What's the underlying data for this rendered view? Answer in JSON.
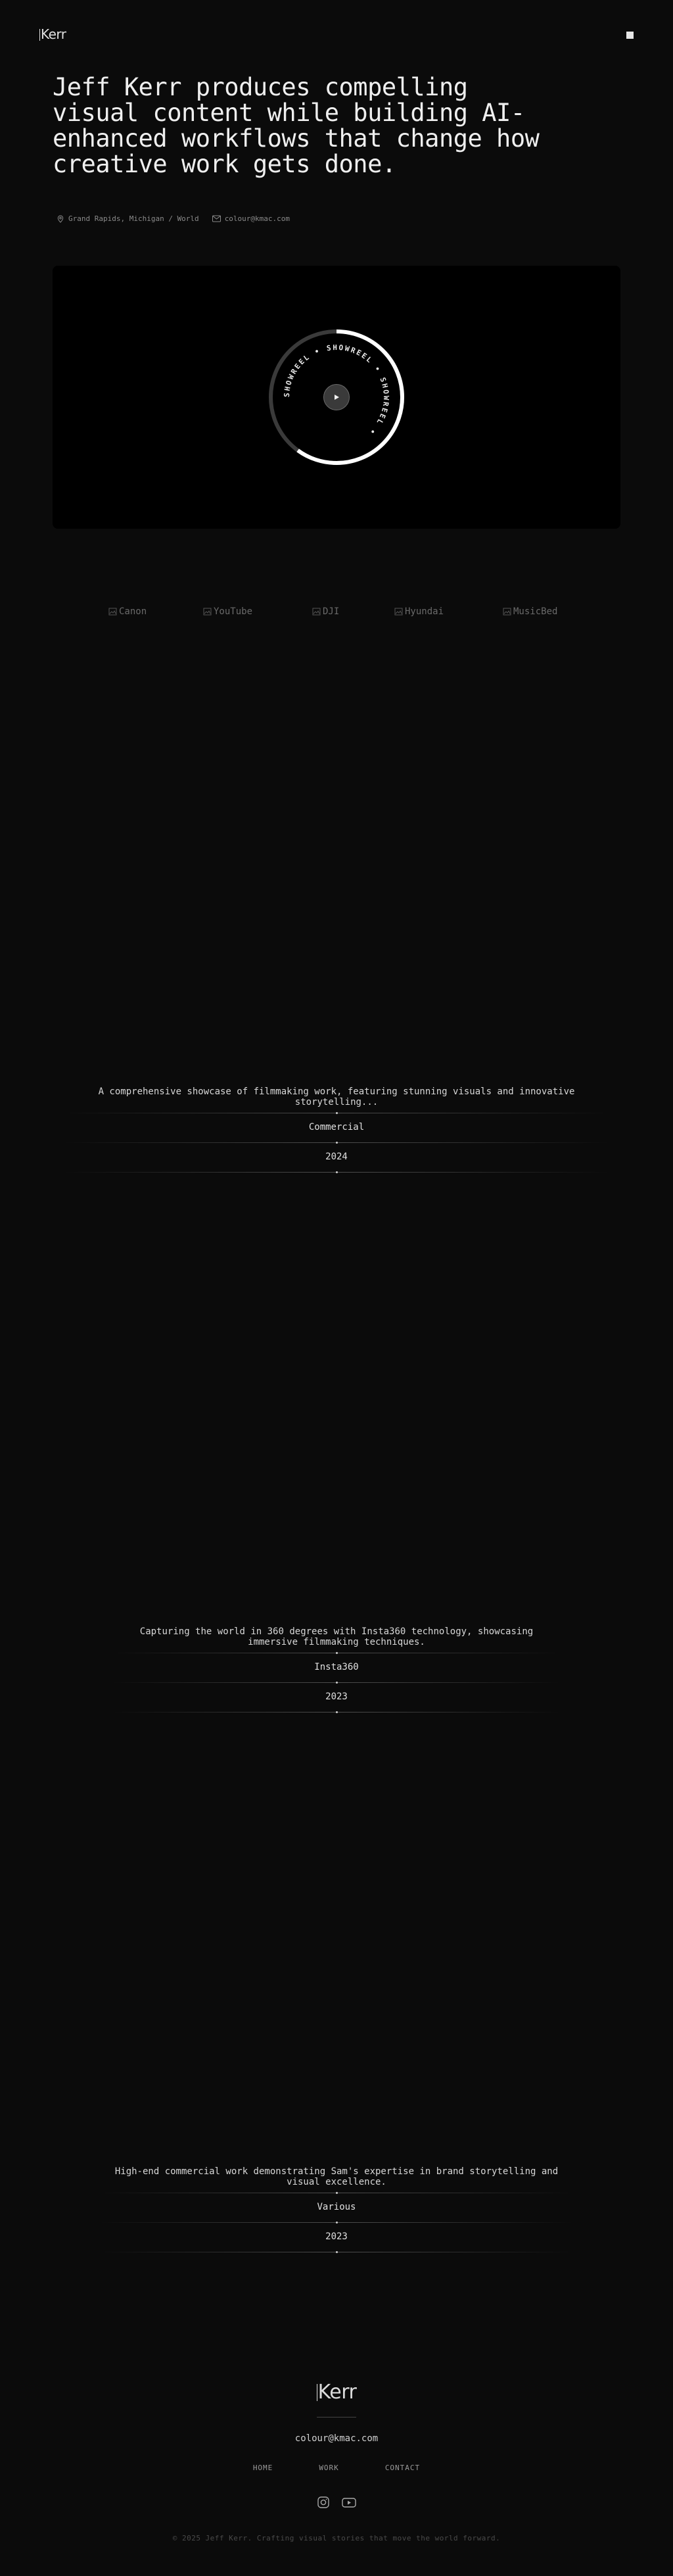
{
  "header": {
    "logo_text": "Kerr",
    "menu_icon": "square-menu-icon"
  },
  "hero": {
    "title": "Jeff Kerr produces compelling visual content while building AI-enhanced workflows that change how creative work gets done.",
    "location": "Grand Rapids, Michigan / World",
    "location_icon": "location-pin-icon",
    "email": "colour@kmac.com",
    "email_icon": "mail-icon"
  },
  "showreel": {
    "ring_text": "SHOWREEL • SHOWREEL • SHOWREEL •",
    "play_icon": "play-icon",
    "progress": 0.6
  },
  "brands": [
    {
      "label": "Canon"
    },
    {
      "label": "YouTube"
    },
    {
      "label": "DJI"
    },
    {
      "label": "Hyundai"
    },
    {
      "label": "MusicBed"
    }
  ],
  "projects": [
    {
      "description": "A comprehensive showcase of filmmaking work, featuring stunning visuals and innovative storytelling...",
      "client": "Commercial",
      "year": "2024"
    },
    {
      "description": "Capturing the world in 360 degrees with Insta360 technology, showcasing immersive filmmaking techniques.",
      "client": "Insta360",
      "year": "2023"
    },
    {
      "description": "High-end commercial work demonstrating Sam's expertise in brand storytelling and visual excellence.",
      "client": "Various",
      "year": "2023"
    }
  ],
  "footer": {
    "logo_text": "Kerr",
    "email": "colour@kmac.com",
    "nav": [
      "HOME",
      "WORK",
      "CONTACT"
    ],
    "social_icons": [
      "instagram-icon",
      "youtube-icon"
    ],
    "copyright": "© 2025 Jeff Kerr. Crafting visual stories that move the world forward."
  }
}
